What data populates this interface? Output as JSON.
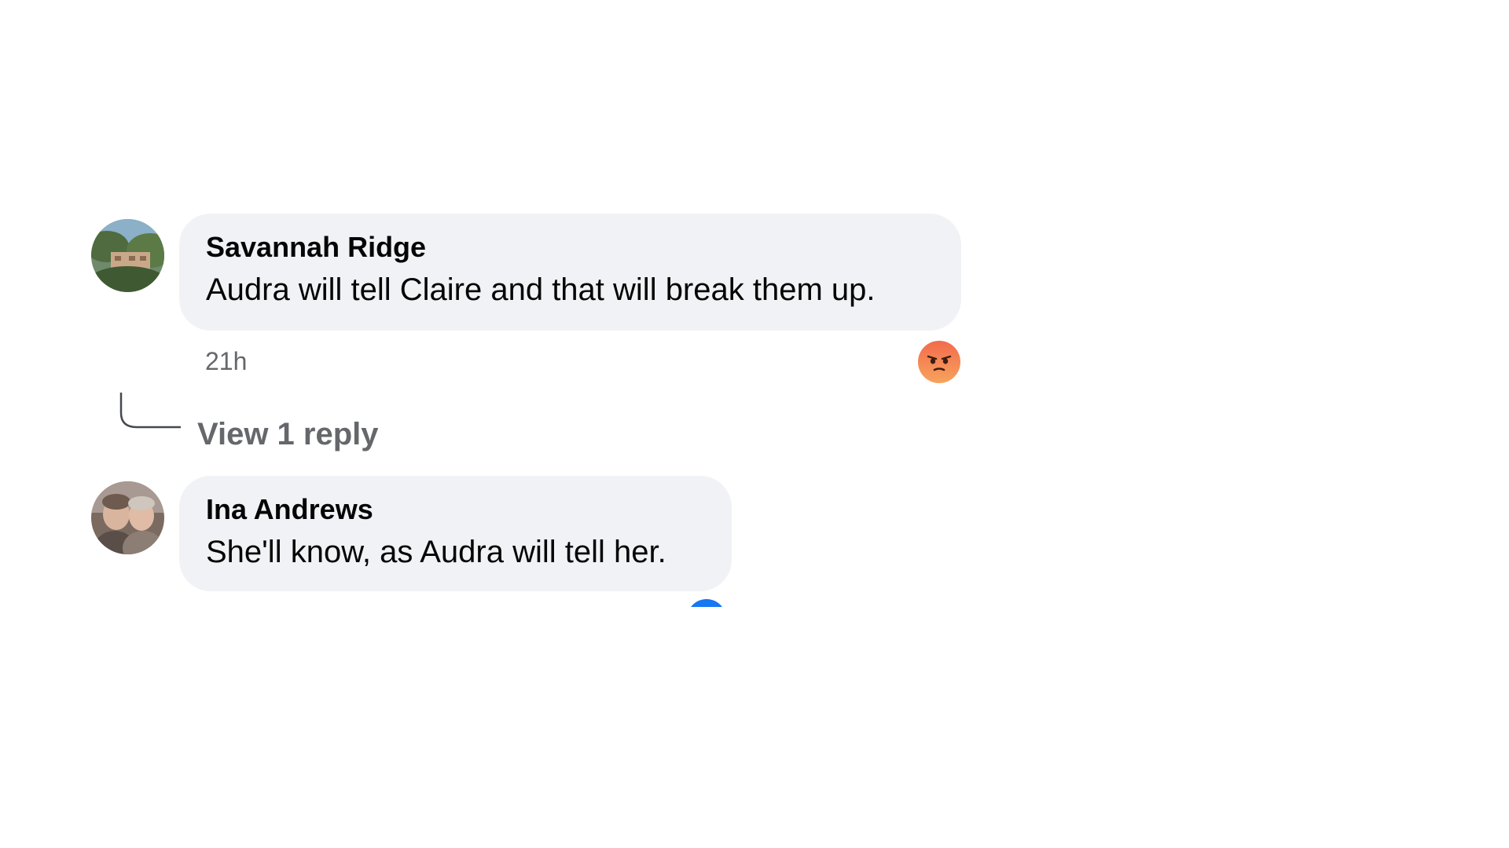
{
  "comments": [
    {
      "author": "Savannah Ridge",
      "text": "Audra will tell Claire and that will break them up.",
      "time": "21h",
      "reaction": "angry-reaction-icon"
    },
    {
      "author": "Ina Andrews",
      "text": "She'll know, as Audra will tell her.",
      "reaction": "like-reaction-icon"
    }
  ],
  "replies_link": "View 1 reply",
  "colors": {
    "bubble": "#f0f2f5",
    "secondary_text": "#65676b",
    "angry": "#f4754a",
    "like": "#1877f2"
  }
}
